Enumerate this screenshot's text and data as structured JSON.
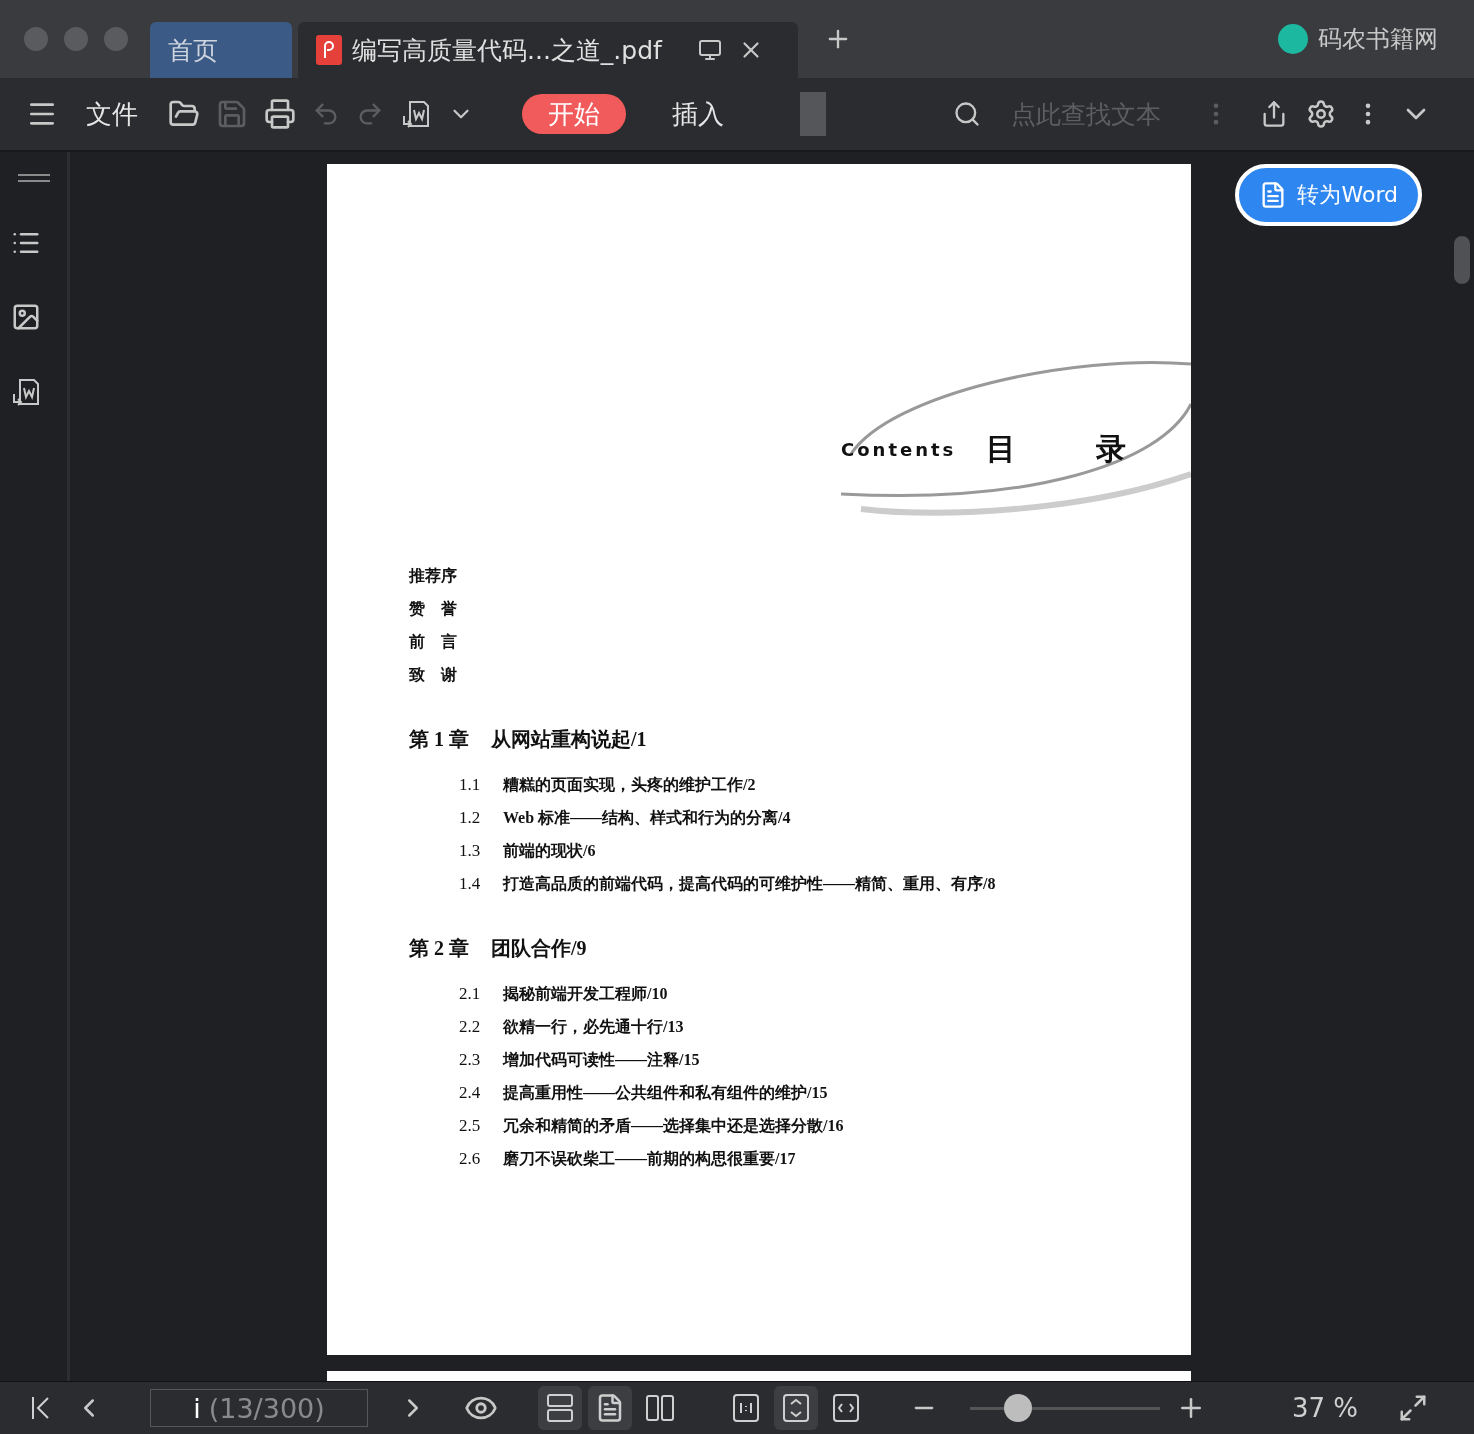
{
  "window": {
    "tabs": [
      {
        "label": "首页",
        "kind": "home",
        "selected": false
      },
      {
        "label": "编写高质量代码...之道_.pdf",
        "kind": "pdf",
        "selected": true
      }
    ],
    "brand": "码农书籍网"
  },
  "toolbar": {
    "menu_label": "文件",
    "ribbon_tabs": [
      {
        "label": "开始",
        "selected": true
      },
      {
        "label": "插入",
        "selected": false
      }
    ],
    "search": {
      "placeholder": "点此查找文本"
    }
  },
  "convert_button": "转为Word",
  "document": {
    "heading_en": "Contents",
    "heading_zh": [
      "目",
      "录"
    ],
    "front_matter": [
      "推荐序",
      "赞　誉",
      "前　言",
      "致　谢"
    ],
    "chapters": [
      {
        "number": "第 1 章",
        "title": "从网站重构说起/1",
        "sections": [
          {
            "number": "1.1",
            "title": "糟糕的页面实现，头疼的维护工作/2"
          },
          {
            "number": "1.2",
            "title": "Web 标准——结构、样式和行为的分离/4"
          },
          {
            "number": "1.3",
            "title": "前端的现状/6"
          },
          {
            "number": "1.4",
            "title": "打造高品质的前端代码，提高代码的可维护性——精简、重用、有序/8"
          }
        ]
      },
      {
        "number": "第 2 章",
        "title": "团队合作/9",
        "sections": [
          {
            "number": "2.1",
            "title": "揭秘前端开发工程师/10"
          },
          {
            "number": "2.2",
            "title": "欲精一行，必先通十行/13"
          },
          {
            "number": "2.3",
            "title": "增加代码可读性——注释/15"
          },
          {
            "number": "2.4",
            "title": "提高重用性——公共组件和私有组件的维护/15"
          },
          {
            "number": "2.5",
            "title": "冗余和精简的矛盾——选择集中还是选择分散/16"
          },
          {
            "number": "2.6",
            "title": "磨刀不误砍柴工——前期的构思很重要/17"
          }
        ]
      }
    ]
  },
  "status_bar": {
    "page_label": "i",
    "page_count": "(13/300)",
    "view_modes": [
      {
        "kind": "continuous",
        "selected": true
      },
      {
        "kind": "single",
        "selected": true
      },
      {
        "kind": "double",
        "selected": false
      }
    ],
    "fit_modes": [
      {
        "kind": "actual",
        "selected": false
      },
      {
        "kind": "fit",
        "selected": true
      },
      {
        "kind": "width",
        "selected": false
      }
    ],
    "zoom": {
      "level": 0.25,
      "reading": "37 %"
    }
  }
}
